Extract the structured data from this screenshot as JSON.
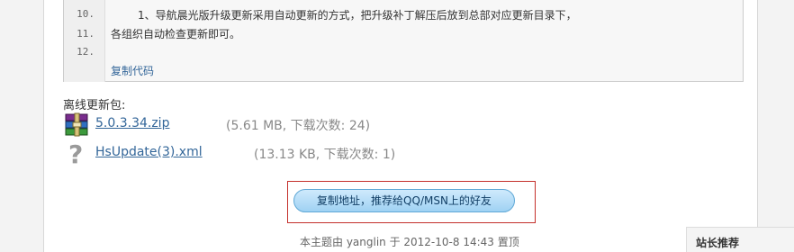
{
  "code": {
    "lines": [
      {
        "num": "10.",
        "text": "1、导航晨光版升级更新采用自动更新的方式，把升级补丁解压后放到总部对应更新目录下，"
      },
      {
        "num": "11.",
        "text": "各组织自动检查更新即可。"
      },
      {
        "num": "12.",
        "text": ""
      }
    ],
    "copy_label": "复制代码"
  },
  "offline": {
    "title": "离线更新包:",
    "attachments": [
      {
        "name": "5.0.3.34.zip",
        "meta": "(5.61 MB, 下载次数: 24)",
        "icon": "archive-icon"
      },
      {
        "name": "HsUpdate(3).xml",
        "meta": "(13.13 KB, 下载次数: 1)",
        "icon": "unknown-file-icon"
      }
    ]
  },
  "share": {
    "label": "复制地址，推荐给QQ/MSN上的好友"
  },
  "footer": {
    "text": "本主题由 yanglin 于 2012-10-8 14:43 置顶"
  },
  "sidebar": {
    "title": "站长推荐"
  },
  "colors": {
    "link": "#336699",
    "frame": "#c4302b"
  }
}
